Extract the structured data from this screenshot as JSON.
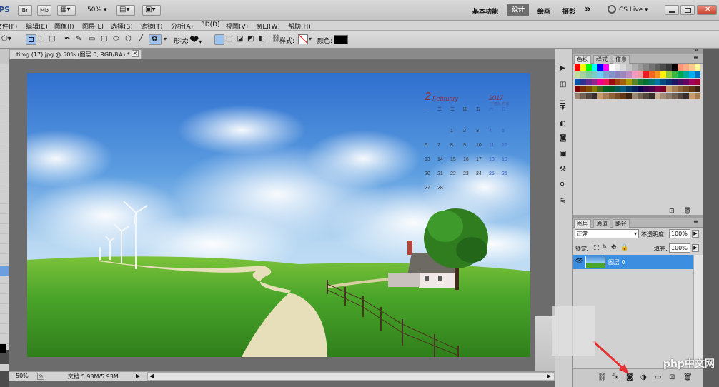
{
  "app": {
    "logo": "PS",
    "quick_buttons": [
      "Br",
      "Mb"
    ],
    "zoom": "50%",
    "workspaces": [
      "基本功能",
      "设计",
      "绘画",
      "摄影"
    ],
    "active_workspace": "设计",
    "more": "»",
    "cs_live": "CS Live",
    "window_buttons": [
      "minimize",
      "restore",
      "close"
    ]
  },
  "menu": {
    "items": [
      "文件(F)",
      "编辑(E)",
      "图像(I)",
      "图层(L)",
      "选择(S)",
      "滤镜(T)",
      "分析(A)",
      "3D(D)",
      "视图(V)",
      "窗口(W)",
      "帮助(H)"
    ]
  },
  "options": {
    "shape_label": "形状:",
    "style_label": "样式:",
    "color_label": "颜色:",
    "color_value": "#000000"
  },
  "document": {
    "tab_title": "timg (17).jpg @ 50% (图层 0, RGB/8#) *",
    "close": "×"
  },
  "calendar": {
    "month_num": "2",
    "month_name": "February",
    "year": "2017",
    "subtitle": "丁酉年 鸡年",
    "weekdays": [
      "一",
      "二",
      "三",
      "四",
      "五",
      "六",
      "日"
    ],
    "rows": [
      [
        "",
        "",
        "1",
        "2",
        "3",
        "4",
        "5"
      ],
      [
        "6",
        "7",
        "8",
        "9",
        "10",
        "11",
        "12"
      ],
      [
        "13",
        "14",
        "15",
        "16",
        "17",
        "18",
        "19"
      ],
      [
        "20",
        "21",
        "22",
        "23",
        "24",
        "25",
        "26"
      ],
      [
        "27",
        "28",
        "",
        "",
        "",
        "",
        ""
      ]
    ]
  },
  "status": {
    "zoom": "50%",
    "doc_info": "文档:5.93M/5.93M"
  },
  "swatches_panel": {
    "tabs": [
      "色板",
      "样式",
      "信息"
    ],
    "active": "色板",
    "colors": [
      "#ff0000",
      "#ffff00",
      "#00ff00",
      "#00ffff",
      "#0000ff",
      "#ff00ff",
      "#ffffff",
      "#ebebeb",
      "#d7d7d7",
      "#c3c3c3",
      "#afafaf",
      "#9b9b9b",
      "#878787",
      "#737373",
      "#5f5f5f",
      "#4b4b4b",
      "#373737",
      "#000000",
      "#f7977a",
      "#f9ad81",
      "#fdc68a",
      "#fff79a",
      "#c4df9b",
      "#a2d39c",
      "#82ca9d",
      "#7bcdc8",
      "#6ecff6",
      "#7ea7d8",
      "#8493ca",
      "#8882be",
      "#a187be",
      "#bc8dbf",
      "#f49ac2",
      "#f6989d",
      "#ed1c24",
      "#f26522",
      "#f7941d",
      "#fff200",
      "#8dc73f",
      "#39b54a",
      "#00a651",
      "#00a99d",
      "#00aeef",
      "#0072bc",
      "#0054a6",
      "#2e3192",
      "#662d91",
      "#92278f",
      "#ec008c",
      "#ed145b",
      "#9e0b0f",
      "#a0410d",
      "#a3620a",
      "#aba000",
      "#598527",
      "#1a7b30",
      "#007236",
      "#00746b",
      "#0076a3",
      "#004b80",
      "#003471",
      "#1b1464",
      "#440e62",
      "#630460",
      "#9e005d",
      "#9e0039",
      "#790000",
      "#7b2e00",
      "#7d4900",
      "#827b00",
      "#406618",
      "#005e20",
      "#005826",
      "#005952",
      "#005b7f",
      "#003663",
      "#002157",
      "#0d004c",
      "#32004b",
      "#4b0049",
      "#7b0046",
      "#7a0026",
      "#c69c6d",
      "#a67c52",
      "#8c6239",
      "#754c24",
      "#603913",
      "#3c2415",
      "#998675",
      "#736357",
      "#534741",
      "#362f2d",
      "#c69c6d",
      "#a67c52",
      "#8c6239",
      "#754c24",
      "#603913",
      "#3c2415",
      "#998675",
      "#736357",
      "#534741",
      "#362f2d",
      "#c7b299",
      "#a68f7a",
      "#8c7a6b",
      "#736357",
      "#534741",
      "#362f2d",
      "#c69c6d",
      "#a67c52"
    ]
  },
  "layers_panel": {
    "tabs": [
      "图层",
      "通道",
      "路径"
    ],
    "active": "图层",
    "blend_mode": "正常",
    "opacity_label": "不透明度:",
    "opacity": "100%",
    "lock_label": "锁定:",
    "fill_label": "填充:",
    "fill": "100%",
    "layers": [
      {
        "name": "图层 0",
        "visible": true,
        "selected": true
      }
    ]
  },
  "watermark": "php中文网",
  "colors": {
    "accent_selected": "#3b8ee0",
    "sky_top": "#2f6fcf",
    "grass": "#3f9a24"
  }
}
